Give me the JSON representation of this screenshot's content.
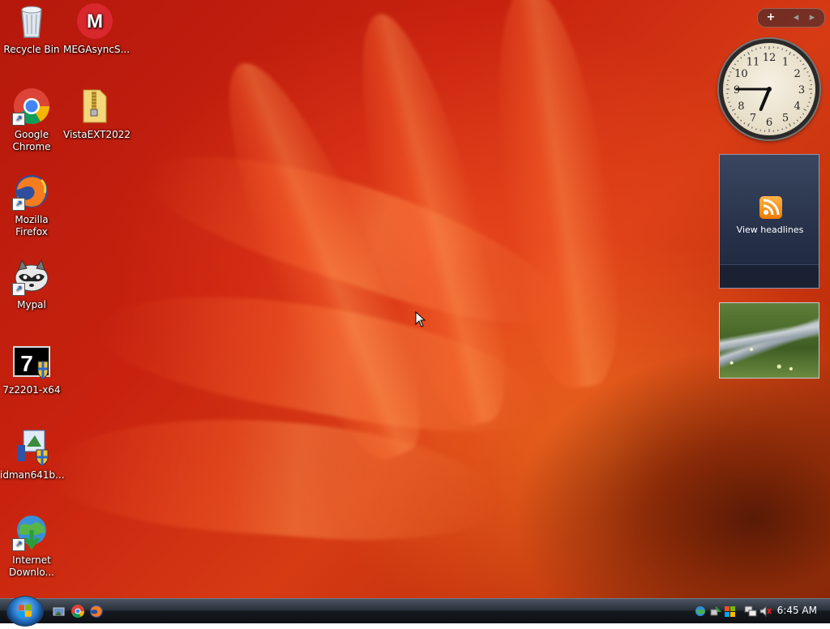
{
  "desktop": {
    "icons": [
      {
        "label": "Recycle Bin",
        "icon": "recycle-bin-icon"
      },
      {
        "label": "MEGAsyncS...",
        "icon": "mega-icon",
        "glyph": "M"
      },
      {
        "label": "Google Chrome",
        "icon": "chrome-icon"
      },
      {
        "label": "VistaEXT2022",
        "icon": "zip-folder-icon"
      },
      {
        "label": "Mozilla Firefox",
        "icon": "firefox-icon"
      },
      {
        "label": "Mypal",
        "icon": "raccoon-icon"
      },
      {
        "label": "7z2201-x64",
        "icon": "7zip-installer-icon",
        "glyph": "7"
      },
      {
        "label": "idman641b...",
        "icon": "idm-installer-icon"
      },
      {
        "label": "Internet Downlo...",
        "icon": "internet-download-manager-icon"
      }
    ]
  },
  "gadgets": {
    "toolbar": {
      "add": "+",
      "prev": "◂",
      "next": "▸"
    },
    "clock": {
      "time": "6:45",
      "numerals": [
        "12",
        "1",
        "2",
        "3",
        "4",
        "5",
        "6",
        "7",
        "8",
        "9",
        "10",
        "11"
      ]
    },
    "headlines": {
      "label": "View headlines"
    },
    "slideshow": {
      "subject": "stream-meadow-photo"
    }
  },
  "taskbar": {
    "start": "start-orb",
    "quick_launch": [
      "show-desktop-icon",
      "chrome-icon",
      "firefox-icon"
    ],
    "tray_icons": [
      "network-globe-icon",
      "safely-remove-icon",
      "windows-update-icon",
      "network-icon",
      "volume-muted-icon"
    ],
    "time": "6:45 AM"
  },
  "colors": {
    "wallpaper": "#c8220f",
    "taskbar": "#161a20",
    "mega_red": "#d9272e",
    "rss_orange": "#f07a00"
  }
}
